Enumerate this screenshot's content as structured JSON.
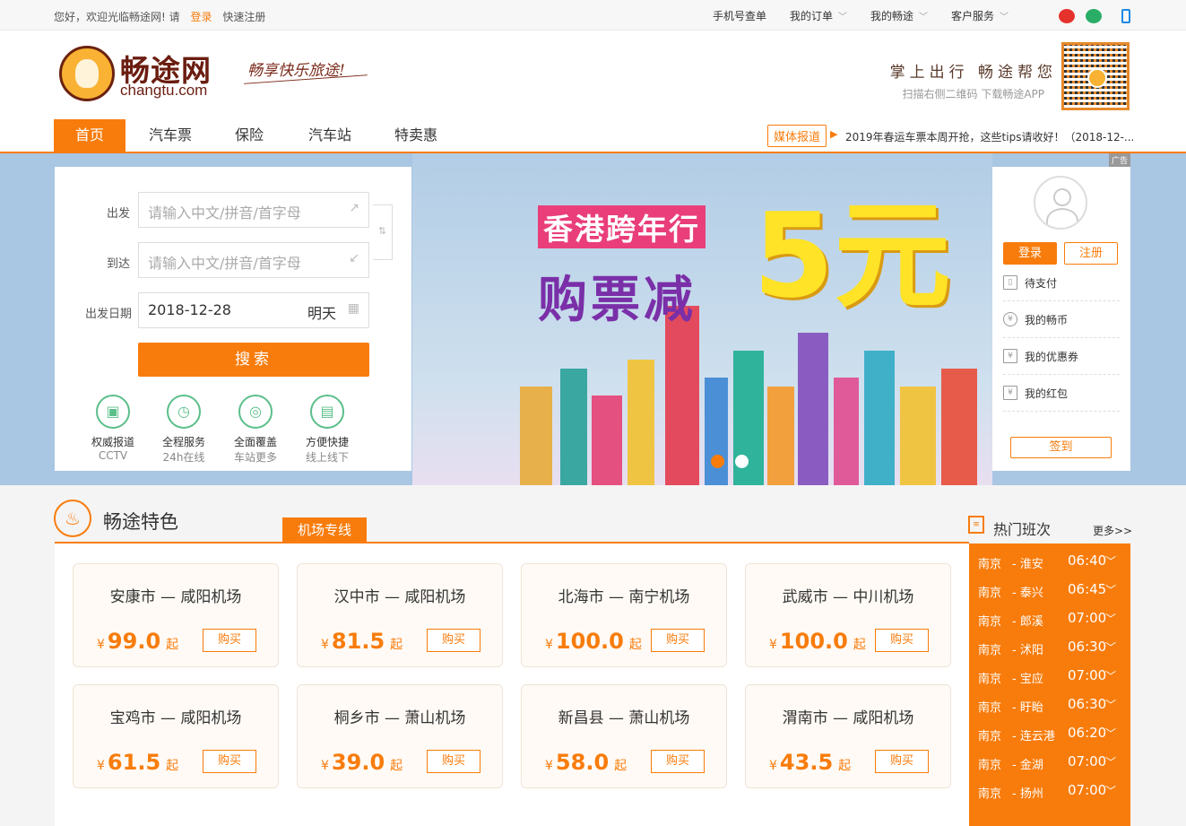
{
  "topbar": {
    "welcome": "您好，欢迎光临畅途网!  请",
    "login": "登录",
    "register": "快速注册",
    "links": [
      {
        "label": "手机号查单",
        "chev": ""
      },
      {
        "label": "我的订单",
        "chev": "﹀"
      },
      {
        "label": "我的畅途",
        "chev": "﹀"
      },
      {
        "label": "客户服务",
        "chev": "﹀"
      }
    ]
  },
  "header": {
    "logo_text": "畅途网",
    "logo_sub": "changtu.com",
    "slogan": "畅享快乐旅途!",
    "app_line1": "掌上出行 畅途帮您",
    "app_line2": "扫描右侧二维码 下载畅途APP"
  },
  "nav": {
    "tabs": [
      "首页",
      "汽车票",
      "保险",
      "汽车站",
      "特卖惠"
    ],
    "media_badge": "媒体报道",
    "media_arrow": "▶",
    "media_text": "2019年春运车票本周开抢，这些tips请收好！（2018-12-..."
  },
  "banner": {
    "ad_tag": "广告",
    "title1": "香港跨年行",
    "title2": "购票减",
    "big": "5元"
  },
  "search": {
    "from_label": "出发",
    "to_label": "到达",
    "date_label": "出发日期",
    "from_placeholder": "请输入中文/拼音/首字母",
    "to_placeholder": "请输入中文/拼音/首字母",
    "date_value": "2018-12-28",
    "date_day": "明天",
    "swap": "⇅",
    "search_button": "搜索",
    "features": [
      {
        "label": "权威报道",
        "sub": "CCTV",
        "icon": "tv-icon",
        "glyph": "▣"
      },
      {
        "label": "全程服务",
        "sub": "24h在线",
        "icon": "clock-icon",
        "glyph": "◷"
      },
      {
        "label": "全面覆盖",
        "sub": "车站更多",
        "icon": "globe-icon",
        "glyph": "◎"
      },
      {
        "label": "方便快捷",
        "sub": "线上线下",
        "icon": "ticket-icon",
        "glyph": "▤"
      }
    ]
  },
  "user": {
    "login": "登录",
    "register": "注册",
    "links": [
      {
        "label": "待支付",
        "glyph": "▯"
      },
      {
        "label": "我的畅币",
        "glyph": "¥"
      },
      {
        "label": "我的优惠券",
        "glyph": "¥"
      },
      {
        "label": "我的红包",
        "glyph": "¥"
      }
    ],
    "signin": "签到"
  },
  "features_section": {
    "title": "畅途特色",
    "tab": "机场专线",
    "cards": [
      {
        "from": "安康市",
        "to": "咸阳机场",
        "price": "99.0"
      },
      {
        "from": "汉中市",
        "to": "咸阳机场",
        "price": "81.5"
      },
      {
        "from": "北海市",
        "to": "南宁机场",
        "price": "100.0"
      },
      {
        "from": "武威市",
        "to": "中川机场",
        "price": "100.0"
      },
      {
        "from": "宝鸡市",
        "to": "咸阳机场",
        "price": "61.5"
      },
      {
        "from": "桐乡市",
        "to": "萧山机场",
        "price": "39.0"
      },
      {
        "from": "新昌县",
        "to": "萧山机场",
        "price": "58.0"
      },
      {
        "from": "渭南市",
        "to": "咸阳机场",
        "price": "43.5"
      }
    ],
    "currency": "¥",
    "from_suffix": "起",
    "buy": "购买",
    "dash": "—"
  },
  "hot": {
    "title": "热门班次",
    "more": "更多>>",
    "rows": [
      {
        "from": "南京",
        "to": "- 淮安",
        "time": "06:40"
      },
      {
        "from": "南京",
        "to": "- 泰兴",
        "time": "06:45"
      },
      {
        "from": "南京",
        "to": "- 郎溪",
        "time": "07:00"
      },
      {
        "from": "南京",
        "to": "- 沭阳",
        "time": "06:30"
      },
      {
        "from": "南京",
        "to": "- 宝应",
        "time": "07:00"
      },
      {
        "from": "南京",
        "to": "- 盱眙",
        "time": "06:30"
      },
      {
        "from": "南京",
        "to": "- 连云港",
        "time": "06:20"
      },
      {
        "from": "南京",
        "to": "- 金湖",
        "time": "07:00"
      },
      {
        "from": "南京",
        "to": "- 扬州",
        "time": "07:00"
      }
    ],
    "chev": "﹀"
  },
  "colors": {
    "accent": "#f87c0c",
    "brand_dark": "#6b1d10",
    "feature_green": "#5bbf8a"
  }
}
